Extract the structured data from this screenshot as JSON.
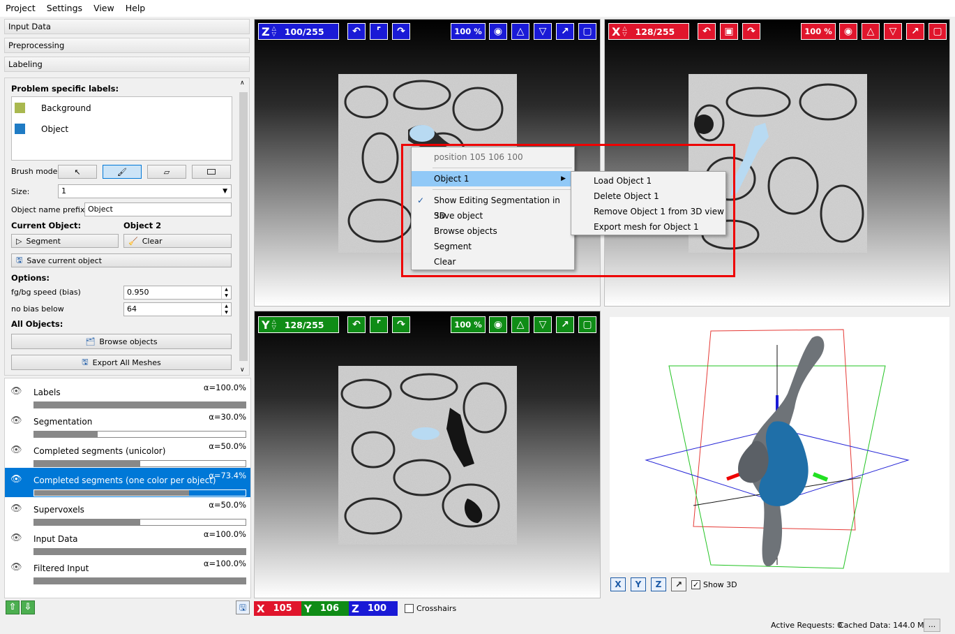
{
  "menubar": [
    "Project",
    "Settings",
    "View",
    "Help"
  ],
  "sections": {
    "input": "Input Data",
    "preprocessing": "Preprocessing",
    "labeling": "Labeling"
  },
  "labeling": {
    "problem_labels_title": "Problem specific labels:",
    "labels": [
      {
        "name": "Background",
        "color": "#a9b84f"
      },
      {
        "name": "Object",
        "color": "#1f7bc4"
      }
    ],
    "brush_mode_label": "Brush mode:",
    "size_label": "Size:",
    "size_value": "1",
    "object_prefix_label": "Object name prefix:",
    "object_prefix_value": "Object",
    "current_object_label": "Current Object:",
    "current_object_value": "Object 2",
    "segment_btn": "Segment",
    "clear_btn": "Clear",
    "save_current_btn": "Save current object",
    "options_label": "Options:",
    "bias_label": "fg/bg speed (bias)",
    "bias_value": "0.950",
    "no_bias_label": "no bias below",
    "no_bias_value": "64",
    "all_objects_label": "All Objects:",
    "browse_btn": "Browse objects",
    "export_btn": "Export All Meshes"
  },
  "layers": [
    {
      "name": "Labels",
      "alpha": "α=100.0%",
      "fill": 1.0
    },
    {
      "name": "Segmentation",
      "alpha": "α=30.0%",
      "fill": 0.3
    },
    {
      "name": "Completed segments (unicolor)",
      "alpha": "α=50.0%",
      "fill": 0.5
    },
    {
      "name": "Completed segments (one color per object)",
      "alpha": "α=73.4%",
      "fill": 0.734,
      "selected": true
    },
    {
      "name": "Supervoxels",
      "alpha": "α=50.0%",
      "fill": 0.5
    },
    {
      "name": "Input Data",
      "alpha": "α=100.0%",
      "fill": 1.0
    },
    {
      "name": "Filtered Input",
      "alpha": "α=100.0%",
      "fill": 1.0
    }
  ],
  "viewers": {
    "z": {
      "axis": "Z",
      "slice": "100/255",
      "zoom": "100 %",
      "color": "#1a1ad6"
    },
    "x": {
      "axis": "X",
      "slice": "128/255",
      "zoom": "100 %",
      "color": "#e0152c"
    },
    "y": {
      "axis": "Y",
      "slice": "128/255",
      "zoom": "100 %",
      "color": "#0f8c16"
    }
  },
  "position": {
    "x_label": "X",
    "x": "105",
    "y_label": "Y",
    "y": "106",
    "z_label": "Z",
    "z": "100",
    "crosshairs": "Crosshairs"
  },
  "view3d": {
    "show3d": "Show 3D",
    "buttons": [
      "X",
      "Y",
      "Z"
    ]
  },
  "status": {
    "active_requests": "Active Requests: 0",
    "cached": "Cached Data: 144.0 MB",
    "more": "..."
  },
  "context_menu": {
    "position": "position 105 106 100",
    "items": [
      "Object 1",
      "Show Editing Segmentation in 3D",
      "Save object",
      "Browse objects",
      "Segment",
      "Clear"
    ],
    "submenu": [
      "Load Object 1",
      "Delete Object 1",
      "Remove Object 1 from 3D view",
      "Export mesh for Object 1"
    ]
  }
}
